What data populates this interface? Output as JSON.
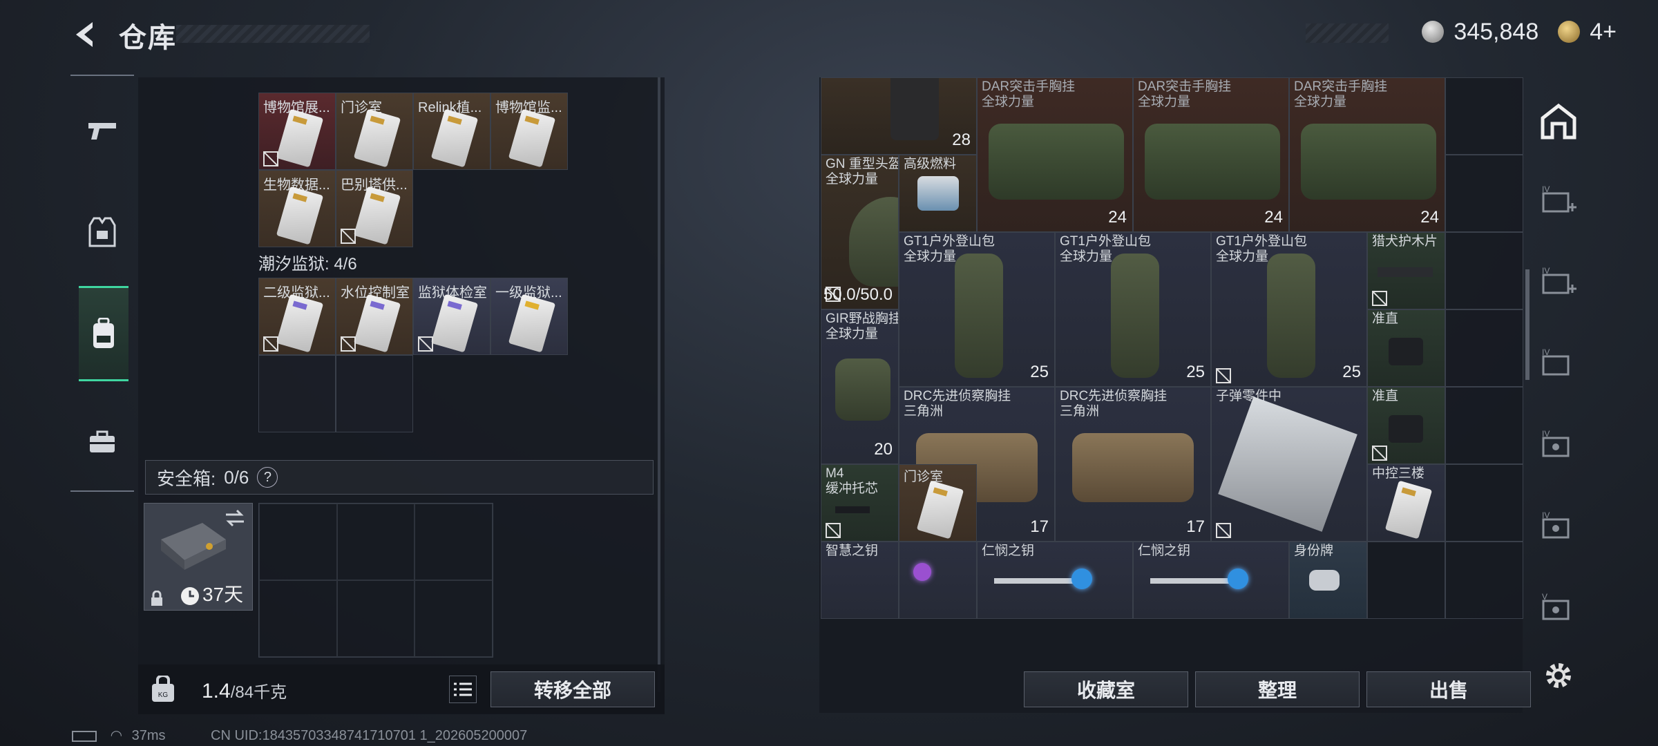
{
  "header": {
    "title": "仓库",
    "currency_value": "345,848",
    "tickets": "4+"
  },
  "rail": {
    "items": [
      "weapon",
      "armor",
      "backpack",
      "toolbox"
    ]
  },
  "left": {
    "group1": {
      "items": [
        {
          "label": "博物馆展...",
          "color": "red",
          "locked": true
        },
        {
          "label": "门诊室",
          "color": "brown",
          "locked": false
        },
        {
          "label": "Relink植...",
          "color": "brown",
          "locked": false
        },
        {
          "label": "博物馆监...",
          "color": "brown",
          "locked": false
        },
        {
          "label": "生物数据...",
          "color": "brown",
          "locked": false
        },
        {
          "label": "巴别塔供...",
          "color": "brown",
          "locked": true
        }
      ]
    },
    "group2": {
      "title": "潮汐监狱: 4/6",
      "items": [
        {
          "label": "二级监狱...",
          "color": "brown",
          "locked": true
        },
        {
          "label": "水位控制室",
          "color": "brown",
          "locked": true
        },
        {
          "label": "监狱体检室",
          "color": "blue",
          "locked": true
        },
        {
          "label": "一级监狱...",
          "color": "blue",
          "locked": false
        }
      ]
    },
    "safe": {
      "label": "安全箱:",
      "count": "0/6",
      "help": "?",
      "timer": "37天"
    },
    "weight": {
      "current": "1.4",
      "max": "/84千克"
    },
    "transfer_all": "转移全部"
  },
  "right": {
    "items": {
      "dar1": {
        "name": "DAR突击手胸挂",
        "sub": "全球力量",
        "count": "24"
      },
      "dar2": {
        "name": "DAR突击手胸挂",
        "sub": "全球力量",
        "count": "24"
      },
      "dar3": {
        "name": "DAR突击手胸挂",
        "sub": "全球力量",
        "count": "24"
      },
      "top_count": "28",
      "helmet": {
        "name": "GN 重型头盔",
        "sub": "全球力量",
        "durability": "50.0/50.0"
      },
      "fuel": {
        "name": "高级燃料"
      },
      "gt1": {
        "name": "GT1户外登山包",
        "sub": "全球力量",
        "count": "25"
      },
      "gt2": {
        "name": "GT1户外登山包",
        "sub": "全球力量",
        "count": "25"
      },
      "gt3": {
        "name": "GT1户外登山包",
        "sub": "全球力量",
        "count": "25"
      },
      "hunter": {
        "name": "猎犬护木片"
      },
      "sight1": {
        "name": "准直"
      },
      "sight2": {
        "name": "准直"
      },
      "gir": {
        "name": "GIR野战胸挂",
        "sub": "全球力量",
        "count": "20"
      },
      "drc1": {
        "name": "DRC先进侦察胸挂",
        "sub": "三角洲",
        "count": "17"
      },
      "drc2": {
        "name": "DRC先进侦察胸挂",
        "sub": "三角洲",
        "count": "17"
      },
      "ammo": {
        "name": "子弹零件中"
      },
      "m4": {
        "name": "M4",
        "sub": "缓冲托芯"
      },
      "clinic": {
        "name": "门诊室"
      },
      "central": {
        "name": "中控三楼"
      },
      "key_wisdom": {
        "name": "智慧之钥"
      },
      "key_mercy1": {
        "name": "仁悯之钥"
      },
      "key_mercy2": {
        "name": "仁悯之钥"
      },
      "dogtag": {
        "name": "身份牌"
      }
    },
    "buttons": {
      "collection": "收藏室",
      "sort": "整理",
      "sell": "出售"
    }
  },
  "footer": {
    "ping": "37ms",
    "uid": "CN UID:18435703348741710701 1_202605200007"
  }
}
